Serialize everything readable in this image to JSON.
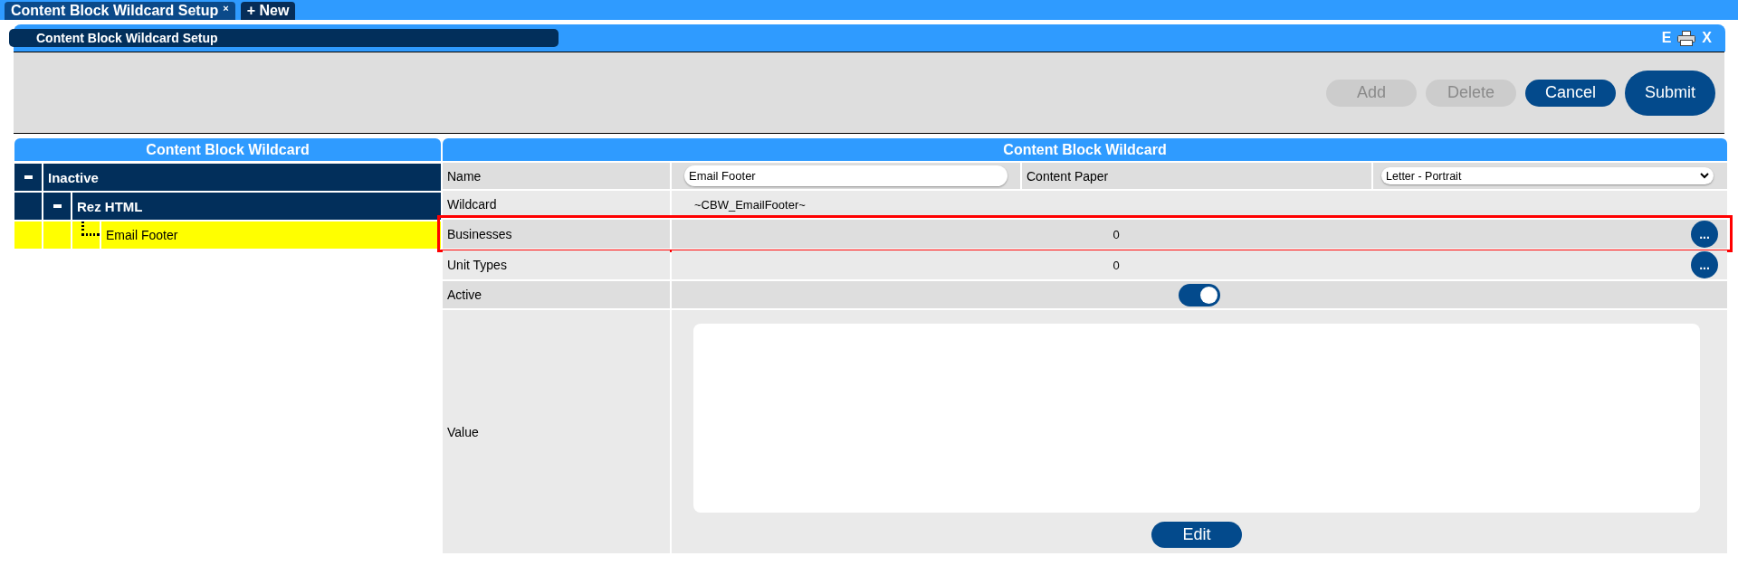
{
  "tabs": [
    {
      "label": "Content Block Wildcard Setup",
      "close": "×",
      "selected": true
    },
    {
      "label": "+ New",
      "selected": false
    }
  ],
  "window": {
    "title": "Content Block Wildcard Setup",
    "export_label": "E",
    "close_label": "X"
  },
  "toolbar": {
    "buttons": [
      {
        "label": "Add",
        "kind": "normal",
        "disabled": true
      },
      {
        "label": "Delete",
        "kind": "normal",
        "disabled": true
      },
      {
        "label": "Cancel",
        "kind": "normal",
        "disabled": false
      },
      {
        "label": "Submit",
        "kind": "large",
        "disabled": false
      }
    ]
  },
  "tree": {
    "title": "Content Block Wildcard",
    "items": [
      {
        "label": "Inactive",
        "expanded": true,
        "selected": false,
        "children": [
          {
            "label": "Rez HTML",
            "expanded": true,
            "selected": false,
            "children": [
              {
                "label": "Email Footer",
                "selected": true
              }
            ]
          }
        ]
      }
    ]
  },
  "form": {
    "title": "Content Block Wildcard",
    "rows": [
      {
        "kind": "name",
        "label": "Name",
        "value": "Email Footer",
        "label_2": "Content Paper",
        "value_2": "Letter - Portrait",
        "highlighted": false
      },
      {
        "kind": "text",
        "label": "Wildcard",
        "value": "~CBW_EmailFooter~",
        "highlighted": false
      },
      {
        "kind": "count",
        "label": "Businesses",
        "value": "0",
        "button": "...",
        "highlighted": true
      },
      {
        "kind": "count",
        "label": "Unit Types",
        "value": "0",
        "button": "...",
        "highlighted": false
      },
      {
        "kind": "toggle",
        "label": "Active",
        "on": true,
        "highlighted": false
      },
      {
        "kind": "editor",
        "label": "Value",
        "button": "Edit",
        "highlighted": false
      }
    ]
  }
}
